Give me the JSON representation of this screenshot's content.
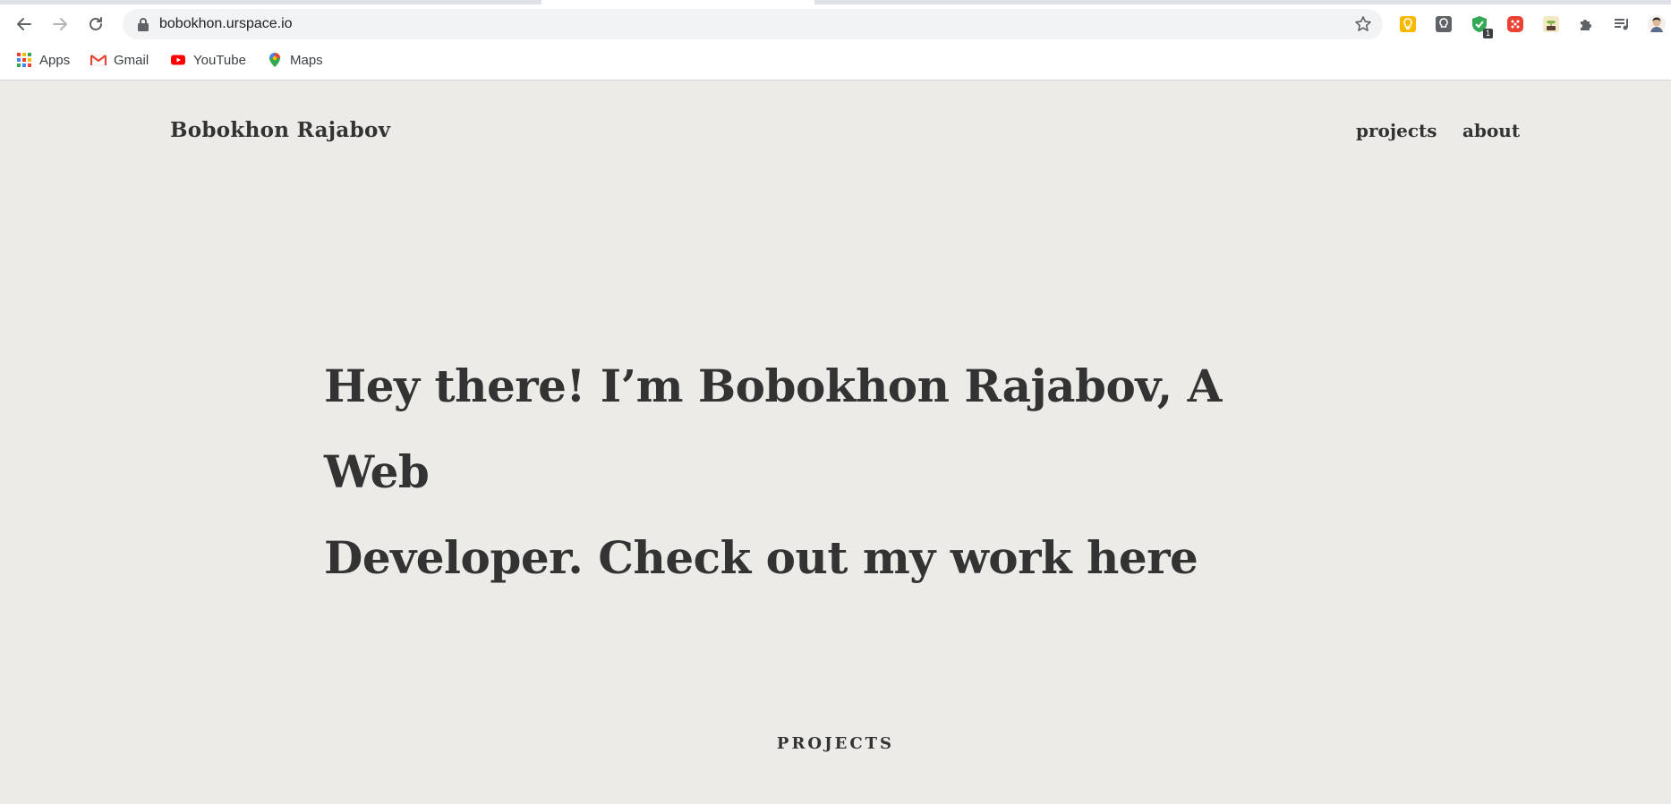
{
  "browser": {
    "url": "bobokhon.urspace.io",
    "nav_icons": [
      "back-arrow-icon",
      "forward-arrow-icon",
      "reload-icon"
    ],
    "extensions": [
      {
        "name": "lightbulb-extension-icon",
        "color": "#f6b900"
      },
      {
        "name": "keep-extension-icon",
        "color": "#5f6368"
      },
      {
        "name": "shield-extension-icon",
        "color": "#34a853",
        "badge": "1"
      },
      {
        "name": "red-extension-icon",
        "color": "#ea4335"
      },
      {
        "name": "plant-extension-icon",
        "color": "#7cb342"
      },
      {
        "name": "puzzle-extensions-icon",
        "color": "#5f6368"
      },
      {
        "name": "media-queue-icon",
        "color": "#5f6368"
      },
      {
        "name": "profile-avatar",
        "color": "#e0b99a"
      }
    ],
    "bookmarks": [
      {
        "label": "Apps",
        "icon": "apps-grid-icon"
      },
      {
        "label": "Gmail",
        "icon": "gmail-icon"
      },
      {
        "label": "YouTube",
        "icon": "youtube-icon"
      },
      {
        "label": "Maps",
        "icon": "maps-icon"
      }
    ]
  },
  "site": {
    "name": "Bobokhon Rajabov",
    "nav": {
      "projects": "projects",
      "about": "about"
    },
    "hero_line1": "Hey there! I’m Bobokhon Rajabov, A Web",
    "hero_line2": "Developer. Check out my work here",
    "section_title": "PROJECTS"
  },
  "colors": {
    "page_bg": "#ecebe8",
    "text": "#333333",
    "omnibox_bg": "#f1f3f4"
  }
}
